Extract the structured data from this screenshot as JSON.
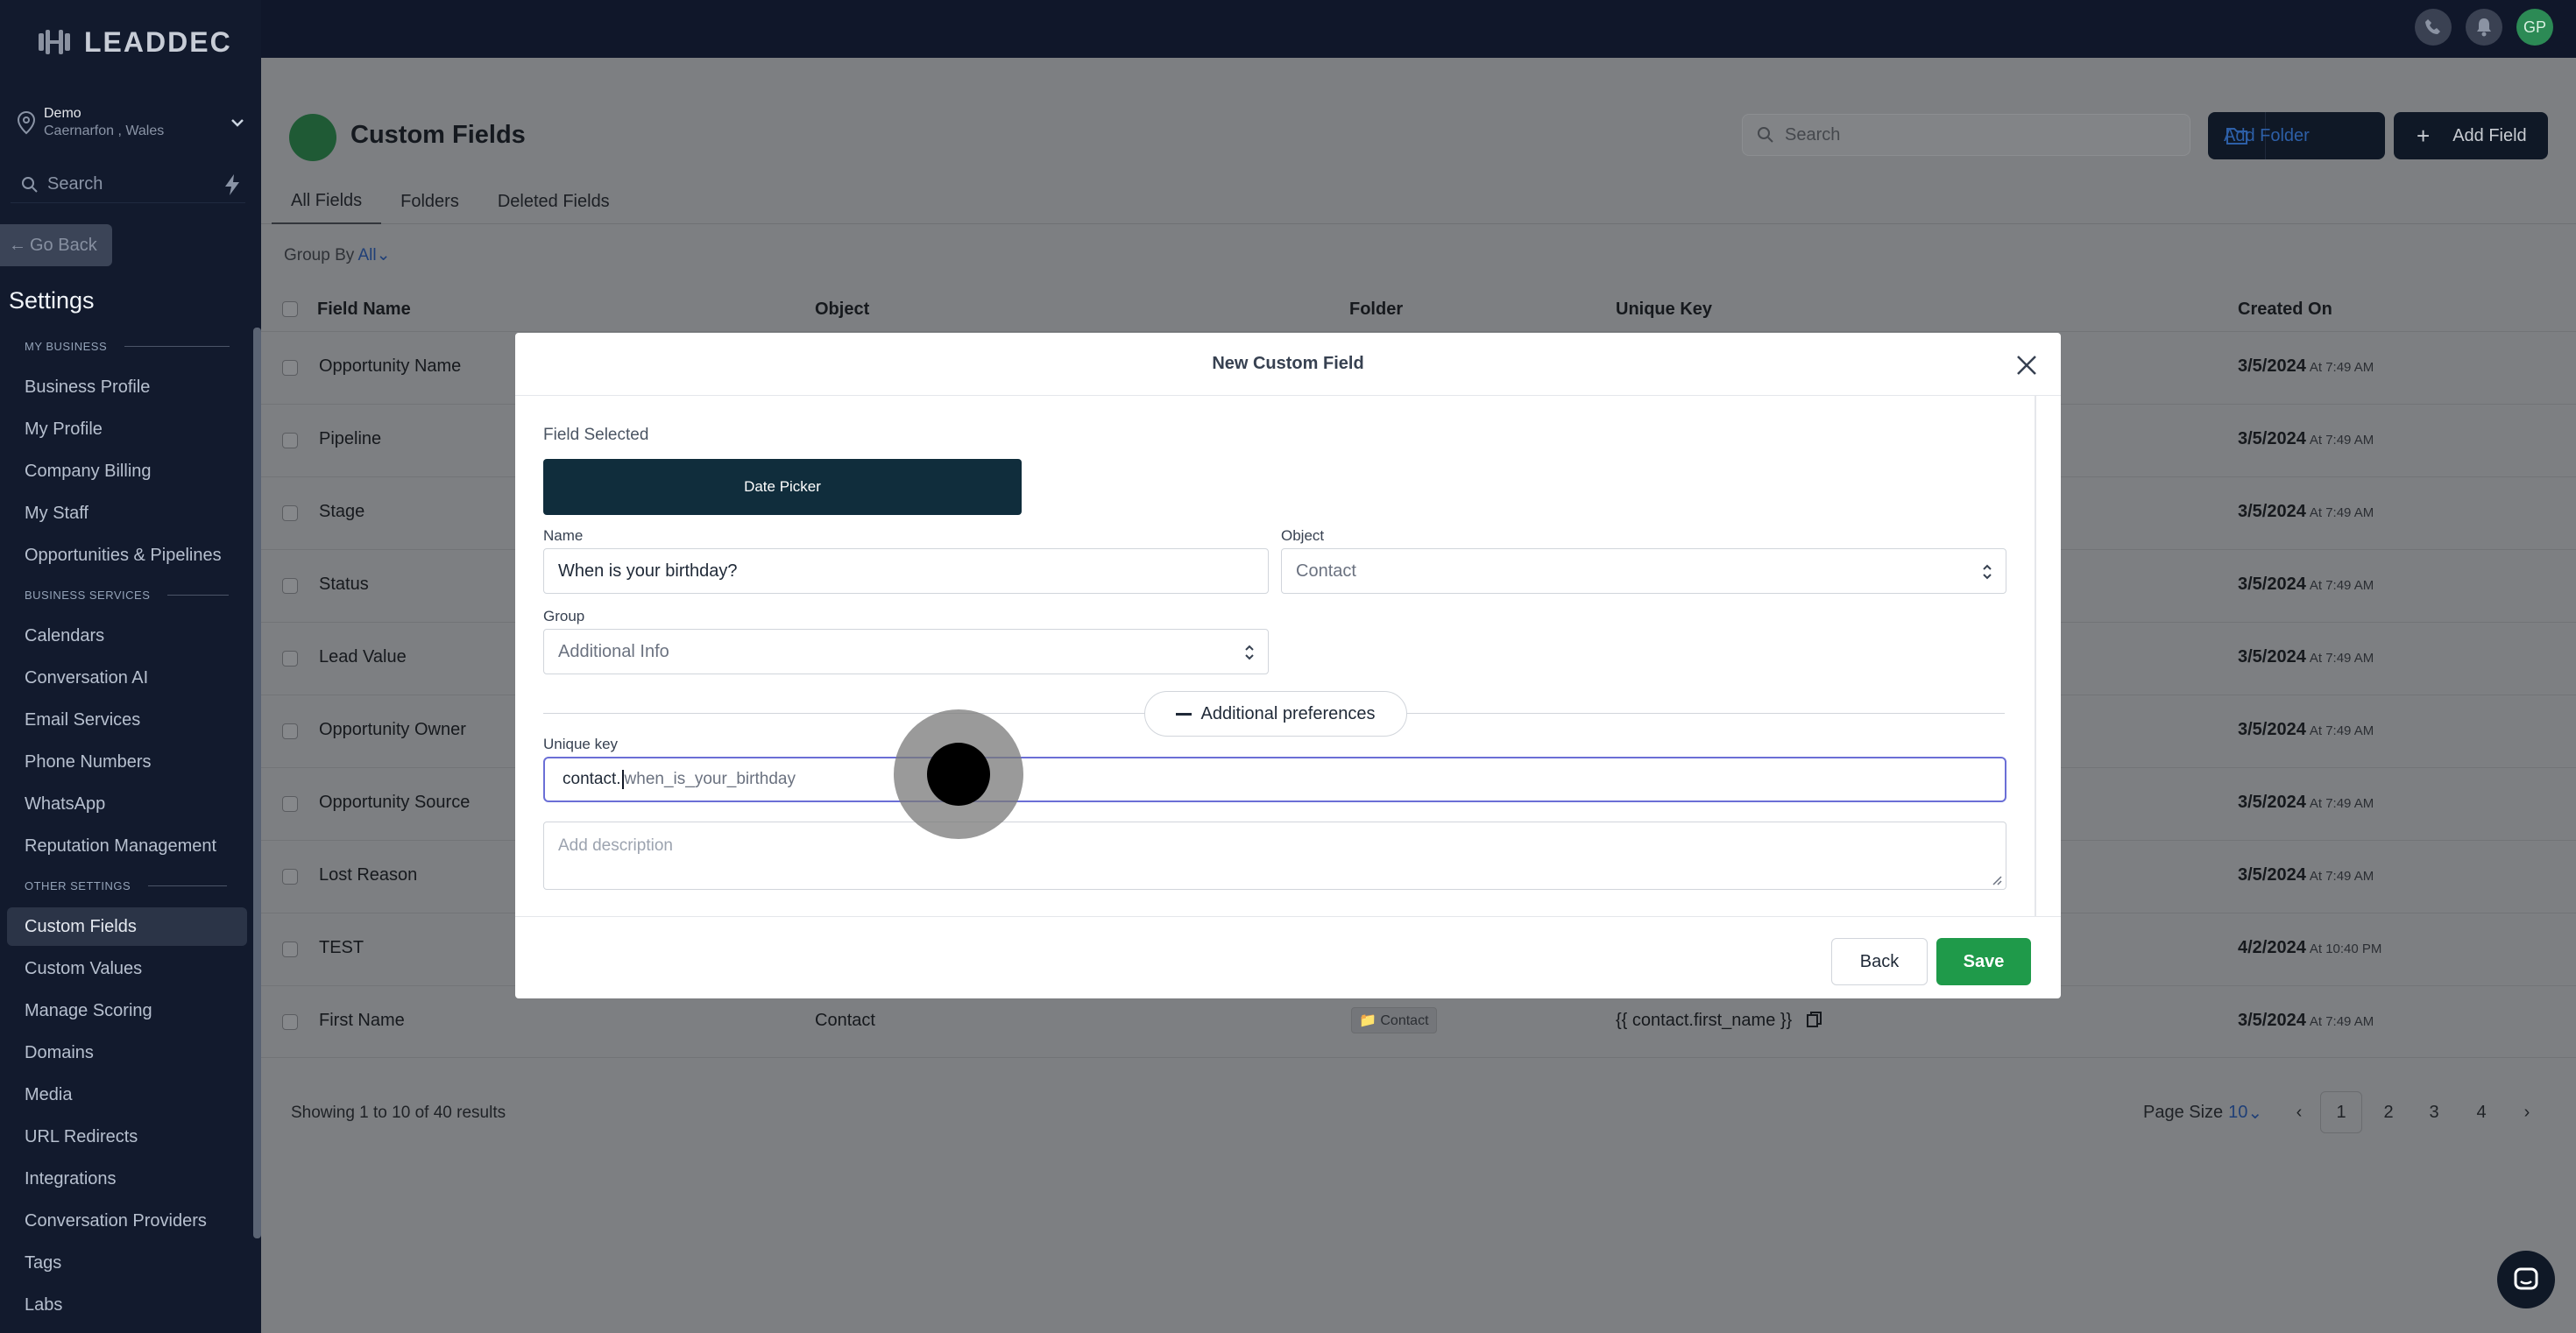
{
  "sidebar": {
    "brand": "LEADDEC",
    "location_name": "Demo",
    "location_sub": "Caernarfon , Wales",
    "search_placeholder": "Search",
    "go_back": "Go Back",
    "title": "Settings",
    "sections": {
      "my_business": "MY BUSINESS",
      "business_services": "BUSINESS SERVICES",
      "other_settings": "OTHER SETTINGS"
    },
    "items": {
      "business_profile": "Business Profile",
      "my_profile": "My Profile",
      "company_billing": "Company Billing",
      "my_staff": "My Staff",
      "opportunities": "Opportunities & Pipelines",
      "calendars": "Calendars",
      "conversation_ai": "Conversation AI",
      "email_services": "Email Services",
      "phone_numbers": "Phone Numbers",
      "whatsapp": "WhatsApp",
      "reputation": "Reputation Management",
      "custom_fields": "Custom Fields",
      "custom_values": "Custom Values",
      "manage_scoring": "Manage Scoring",
      "domains": "Domains",
      "media": "Media",
      "url_redirects": "URL Redirects",
      "integrations": "Integrations",
      "conversation_providers": "Conversation Providers",
      "tags": "Tags",
      "labs": "Labs"
    }
  },
  "topbar": {
    "avatar_initials": "GP"
  },
  "page": {
    "title": "Custom Fields",
    "search_placeholder": "Search",
    "add_folder": "Add Folder",
    "add_field": "Add Field",
    "tabs": [
      "All Fields",
      "Folders",
      "Deleted Fields"
    ],
    "group_by_label": "Group By",
    "group_by_value": "All"
  },
  "table": {
    "headers": {
      "field_name": "Field Name",
      "object": "Object",
      "folder": "Folder",
      "unique_key": "Unique Key",
      "created_on": "Created On"
    },
    "rows": [
      {
        "name": "Opportunity Name",
        "date": "3/5/2024",
        "time": "At 7:49 AM"
      },
      {
        "name": "Pipeline",
        "date": "3/5/2024",
        "time": "At 7:49 AM"
      },
      {
        "name": "Stage",
        "date": "3/5/2024",
        "time": "At 7:49 AM"
      },
      {
        "name": "Status",
        "date": "3/5/2024",
        "time": "At 7:49 AM"
      },
      {
        "name": "Lead Value",
        "date": "3/5/2024",
        "time": "At 7:49 AM"
      },
      {
        "name": "Opportunity Owner",
        "date": "3/5/2024",
        "time": "At 7:49 AM"
      },
      {
        "name": "Opportunity Source",
        "date": "3/5/2024",
        "time": "At 7:49 AM"
      },
      {
        "name": "Lost Reason",
        "date": "3/5/2024",
        "time": "At 7:49 AM"
      },
      {
        "name": "TEST",
        "date": "4/2/2024",
        "time": "At 10:40 PM"
      },
      {
        "name": "First Name",
        "object": "Contact",
        "folder": "Contact",
        "key": "{{ contact.first_name }}",
        "date": "3/5/2024",
        "time": "At 7:49 AM"
      }
    ],
    "showing": "Showing",
    "range_start": "1",
    "range_to": "to",
    "range_end": "10",
    "range_of": "of",
    "total": "40",
    "results": "results",
    "page_size_label": "Page Size",
    "page_size_value": "10",
    "pages": [
      "1",
      "2",
      "3",
      "4"
    ]
  },
  "modal": {
    "title": "New Custom Field",
    "field_selected_label": "Field Selected",
    "field_selected_value": "Date Picker",
    "name_label": "Name",
    "name_value": "When is your birthday?",
    "object_label": "Object",
    "object_value": "Contact",
    "group_label": "Group",
    "group_value": "Additional Info",
    "additional_prefs": "Additional preferences",
    "unique_key_label": "Unique key",
    "unique_key_typed": "contact.",
    "unique_key_rest": "when_is_your_birthday",
    "description_placeholder": "Add description",
    "back": "Back",
    "save": "Save"
  },
  "colors": {
    "sidebar_bg": "#121a2d",
    "primary_dark": "#102d3c",
    "save_green": "#1f9a4a",
    "focus_border": "#6b6fd6"
  }
}
